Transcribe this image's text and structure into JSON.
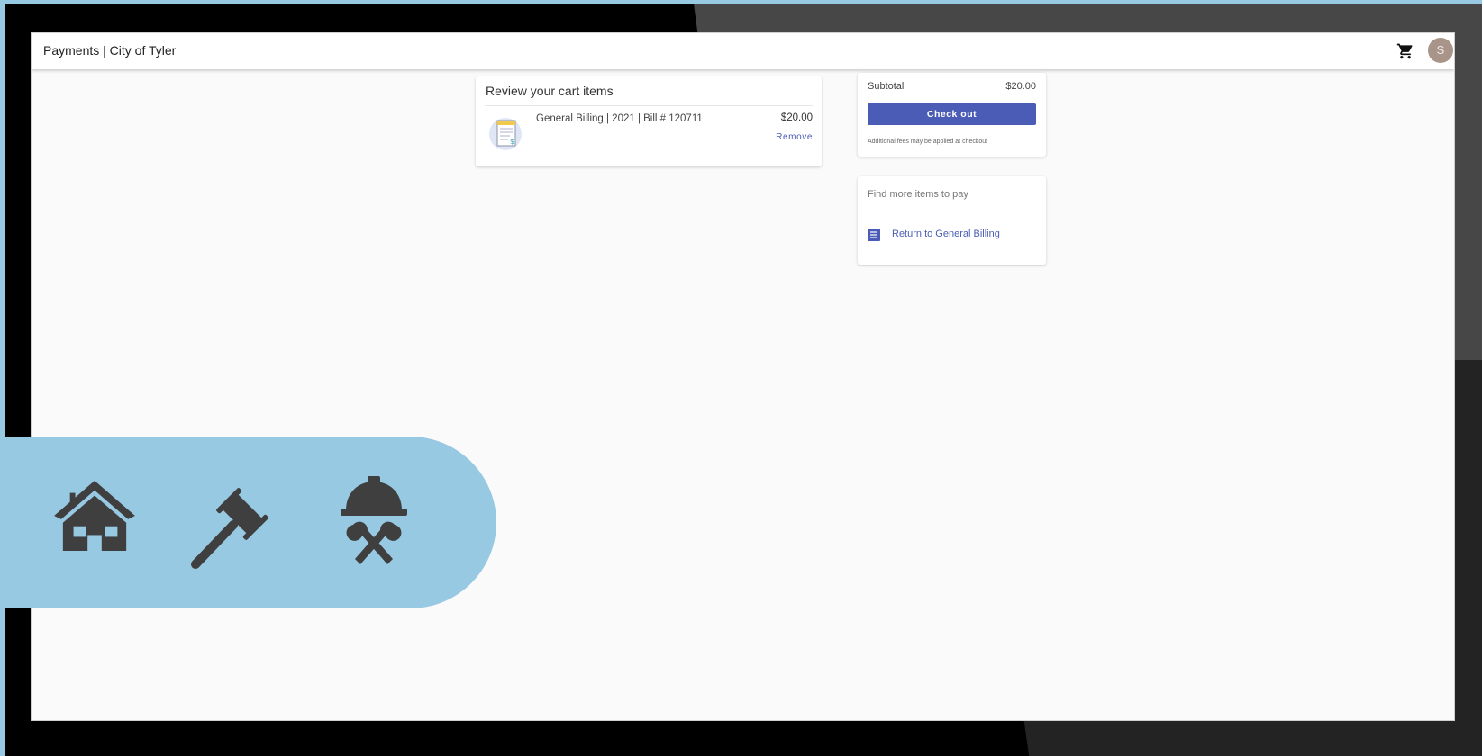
{
  "header": {
    "title": "Payments | City of Tyler",
    "avatar_initial": "S"
  },
  "cart": {
    "title": "Review your cart items",
    "items": [
      {
        "description": "General Billing | 2021 | Bill # 120711",
        "amount": "$20.00",
        "remove_label": "Remove"
      }
    ]
  },
  "summary": {
    "subtotal_label": "Subtotal",
    "subtotal_value": "$20.00",
    "checkout_label": "Check out",
    "fee_note": "Additional fees may be applied at checkout"
  },
  "more": {
    "title": "Find more items to pay",
    "return_label": "Return to General Billing"
  },
  "decor_icons": [
    "house-icon",
    "gavel-icon",
    "hardhat-tools-icon"
  ],
  "colors": {
    "accent": "#4a5cb5",
    "pill": "#98c9e3"
  }
}
